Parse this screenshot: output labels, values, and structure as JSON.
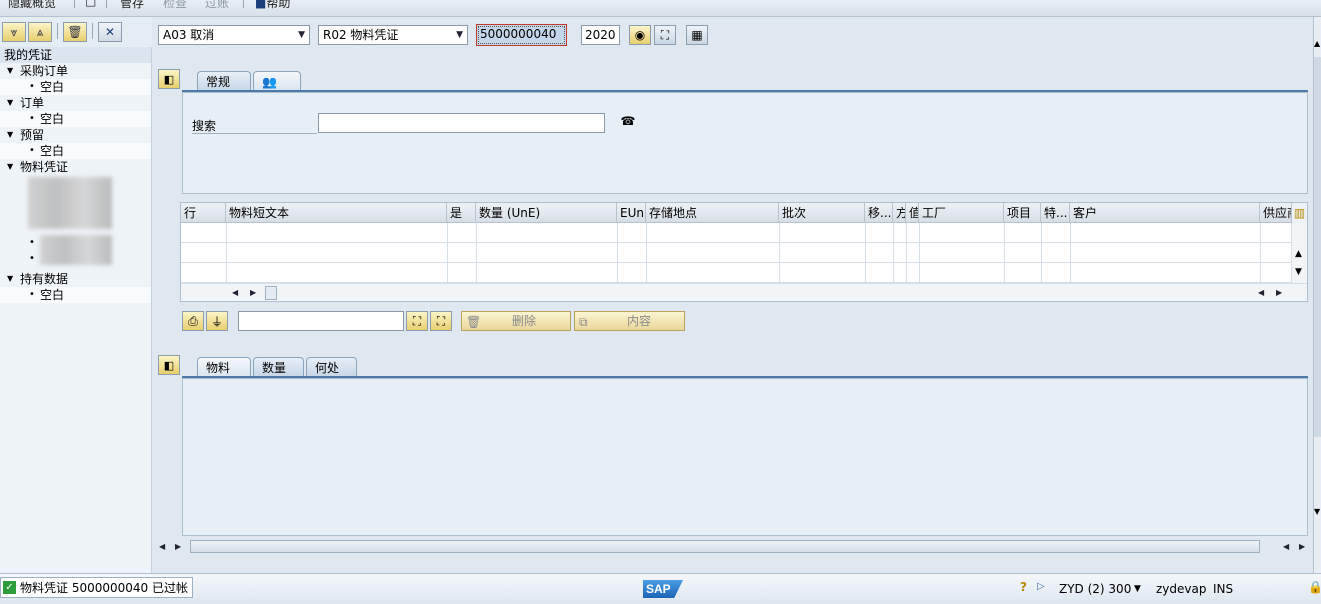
{
  "menu": {
    "items": [
      {
        "label": "隐藏概览",
        "disabled": false
      },
      {
        "label": "",
        "disabled": false,
        "icon": "new-icon"
      },
      {
        "label": "管存",
        "disabled": false
      },
      {
        "label": "检查",
        "disabled": true
      },
      {
        "label": "过账",
        "disabled": true
      },
      {
        "label": "帮助",
        "disabled": false,
        "icon": "help-icon"
      }
    ]
  },
  "left_panel": {
    "header": "我的凭证",
    "tree": [
      {
        "label": "采购订单",
        "children": [
          "空白"
        ]
      },
      {
        "label": "订单",
        "children": [
          "空白"
        ]
      },
      {
        "label": "预留",
        "children": [
          "空白"
        ]
      },
      {
        "label": "物料凭证",
        "children": []
      },
      {
        "label": "持有数据",
        "children": [
          "空白"
        ]
      }
    ]
  },
  "header_fields": {
    "action_select": "A03 取消",
    "reference_select": "R02 物料凭证",
    "doc_number": "5000000040",
    "year": "2020"
  },
  "top_tabs": [
    {
      "label": "常规",
      "active": false
    },
    {
      "label": "",
      "icon": "people-icon",
      "active": true
    }
  ],
  "search": {
    "label": "搜索",
    "value": ""
  },
  "item_table": {
    "columns": [
      "行",
      "物料短文本",
      "是",
      "数量 (UnE)",
      "EUn",
      "存储地点",
      "批次",
      "移...",
      "方",
      "值",
      "工厂",
      "项目",
      "特...",
      "客户",
      "供应商"
    ]
  },
  "table_toolbar": {
    "filter_value": "",
    "delete_label": "删除",
    "content_label": "内容"
  },
  "detail_tabs": [
    {
      "label": "物料",
      "active": true
    },
    {
      "label": "数量",
      "active": false
    },
    {
      "label": "何处",
      "active": false
    }
  ],
  "status_bar": {
    "message": "物料凭证 5000000040 已过帐",
    "logo": "SAP",
    "system": "ZYD (2) 300",
    "server": "zydevap",
    "mode": "INS"
  },
  "colors": {
    "accent": "#4d79a8",
    "panel_bg": "#dfe8f1",
    "button_yellow": "#e8cf6e",
    "status_ok": "#2e9c3a"
  }
}
